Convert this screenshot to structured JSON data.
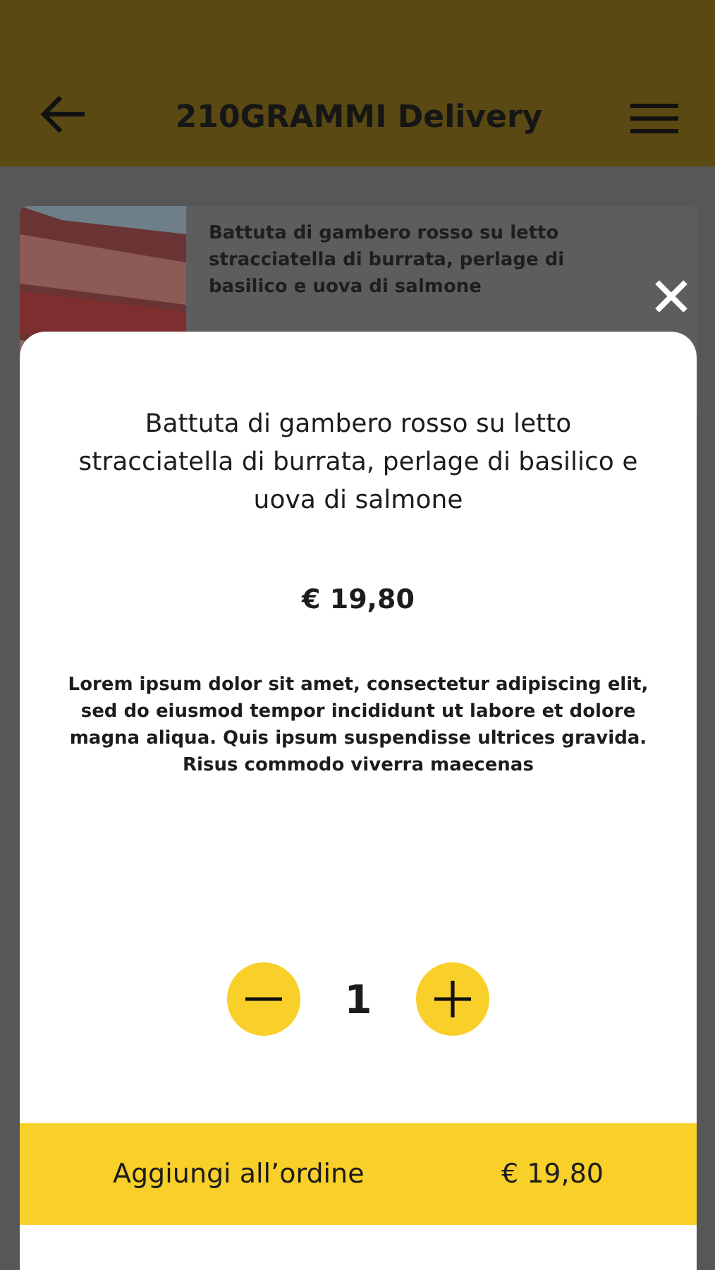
{
  "header": {
    "title": "210GRAMMI Delivery"
  },
  "background_item": {
    "kind": "picture",
    "name": "Battuta di gambero rosso su letto stracciatella di burrata, perlage di basilico e uova di salmone"
  },
  "modal": {
    "title": "Battuta di gambero rosso su letto stracciatella di burrata, perlage di basilico e uova di salmone",
    "price": "€ 19,80",
    "description": "Lorem ipsum dolor sit amet, consectetur adipiscing elit, sed do eiusmod tempor incididunt ut labore et dolore magna aliqua. Quis ipsum suspendisse ultrices gravida. Risus commodo viverra maecenas",
    "quantity": "1",
    "add_button": {
      "label": "Aggiungi all’ordine",
      "total": "€ 19,80"
    }
  }
}
